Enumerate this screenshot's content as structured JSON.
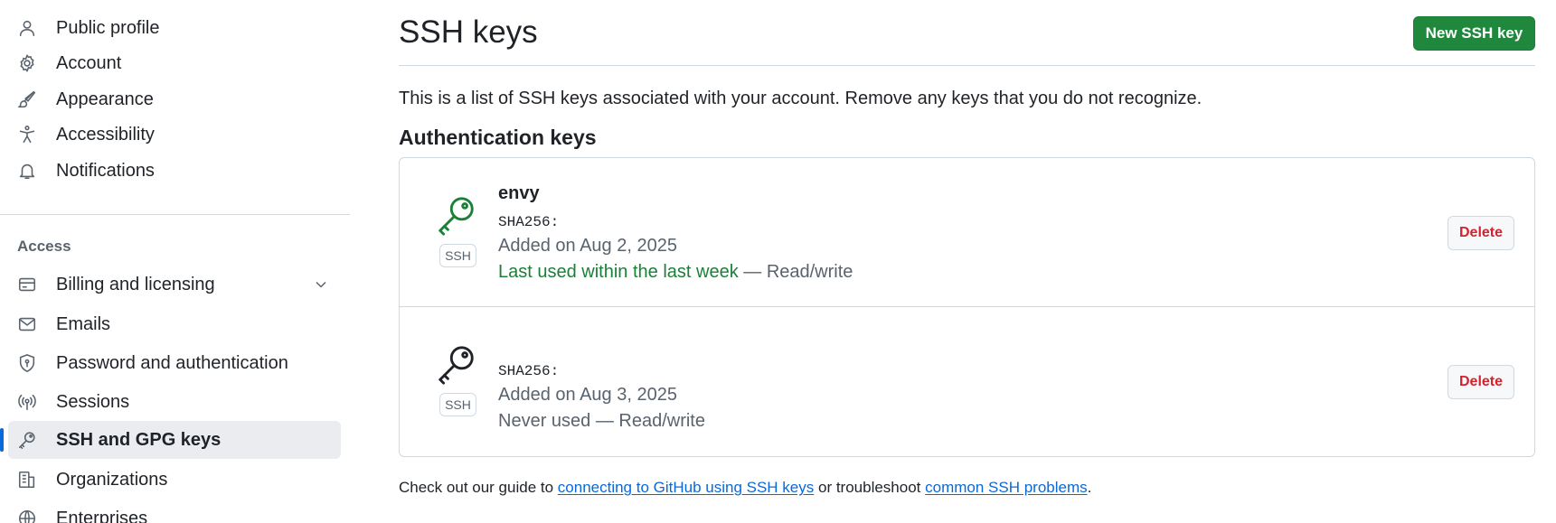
{
  "sidebar": {
    "items_top": [
      {
        "label": "Public profile",
        "icon": "person-icon"
      },
      {
        "label": "Account",
        "icon": "gear-icon"
      },
      {
        "label": "Appearance",
        "icon": "paintbrush-icon"
      },
      {
        "label": "Accessibility",
        "icon": "accessibility-icon"
      },
      {
        "label": "Notifications",
        "icon": "bell-icon"
      }
    ],
    "access_heading": "Access",
    "items_access": [
      {
        "label": "Billing and licensing",
        "icon": "credit-card-icon"
      },
      {
        "label": "Emails",
        "icon": "mail-icon"
      },
      {
        "label": "Password and authentication",
        "icon": "shield-lock-icon"
      },
      {
        "label": "Sessions",
        "icon": "broadcast-icon"
      },
      {
        "label": "SSH and GPG keys",
        "icon": "key-icon"
      },
      {
        "label": "Organizations",
        "icon": "organization-icon"
      },
      {
        "label": "Enterprises",
        "icon": "globe-icon"
      }
    ],
    "active": "SSH and GPG keys"
  },
  "main": {
    "title": "SSH keys",
    "new_button": "New SSH key",
    "description": "This is a list of SSH keys associated with your account. Remove any keys that you do not recognize.",
    "subhead": "Authentication keys",
    "keys": [
      {
        "title": "envy",
        "fingerprint": "SHA256:",
        "added": "Added on Aug 2, 2025",
        "usage_recent": "Last used within the last week",
        "usage_rest": " — Read/write",
        "badge": "SSH",
        "delete_label": "Delete",
        "icon_color": "#1a7f37"
      },
      {
        "title": "",
        "fingerprint": "SHA256:",
        "added": "Added on Aug 3, 2025",
        "usage_recent": "",
        "usage_rest": "Never used — Read/write",
        "badge": "SSH",
        "delete_label": "Delete",
        "icon_color": "#1f2328"
      }
    ],
    "footer": {
      "prefix": "Check out our guide to ",
      "link1": "connecting to GitHub using SSH keys",
      "middle": " or troubleshoot ",
      "link2": "common SSH problems",
      "suffix": "."
    }
  },
  "colors": {
    "primary_button": "#1f883d",
    "danger": "#d1242f",
    "link": "#0969da",
    "success": "#1a7f37",
    "active_indicator": "#0969da"
  }
}
